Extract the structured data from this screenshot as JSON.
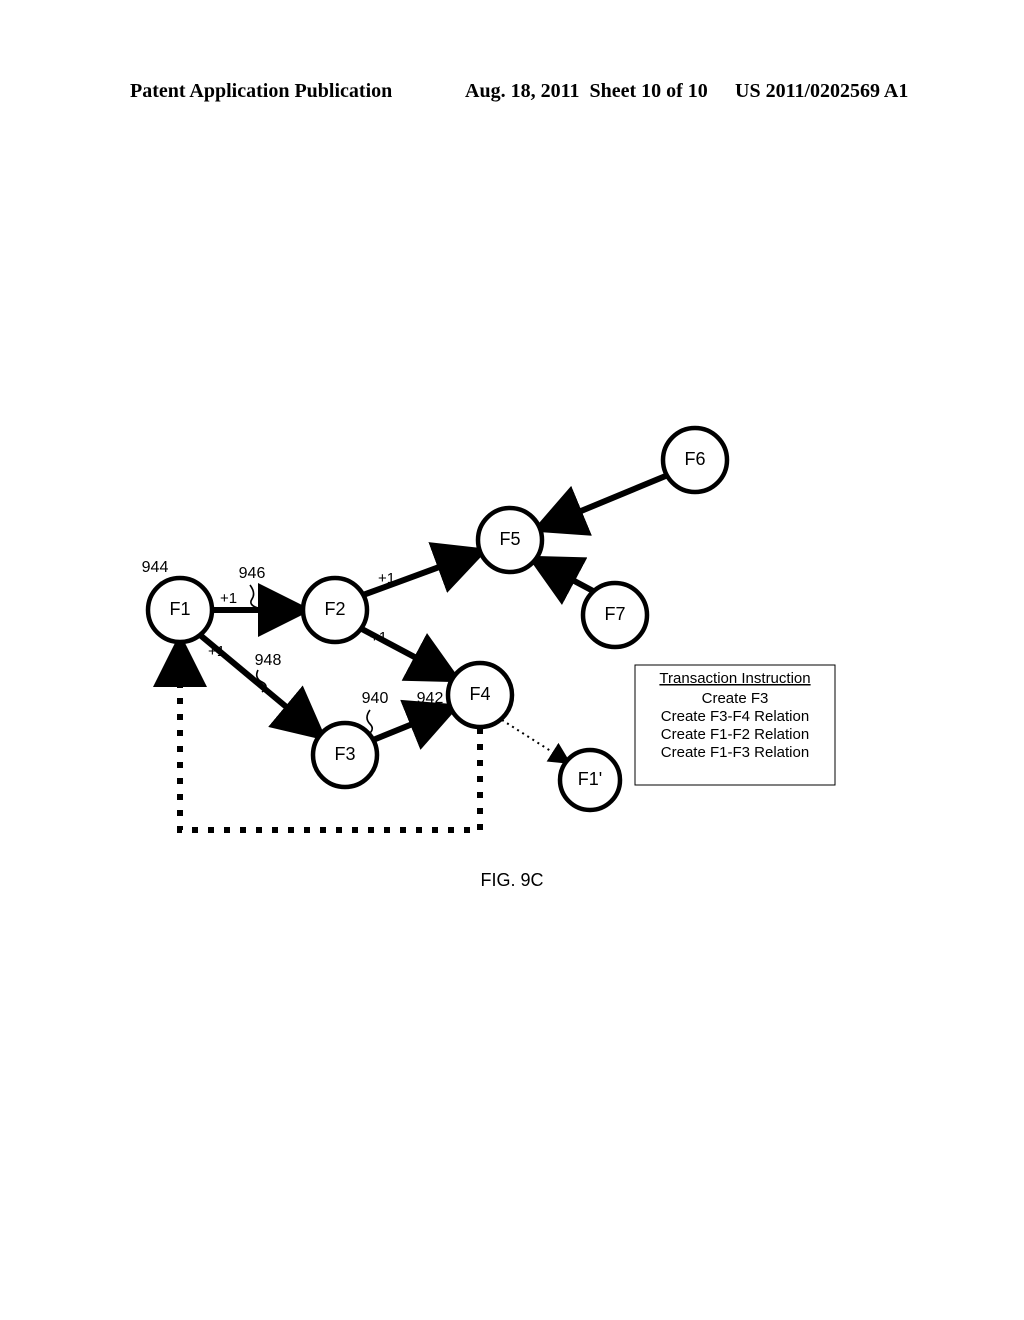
{
  "header": {
    "left": "Patent Application Publication",
    "date": "Aug. 18, 2011",
    "sheet": "Sheet 10 of 10",
    "pubno": "US 2011/0202569 A1"
  },
  "figure_caption": "FIG. 9C",
  "nodes": {
    "F1": "F1",
    "F2": "F2",
    "F3": "F3",
    "F4": "F4",
    "F5": "F5",
    "F6": "F6",
    "F7": "F7",
    "F1p": "F1'"
  },
  "refs": {
    "r944": "944",
    "r946": "946",
    "r940": "940",
    "r942": "942",
    "r948": "948"
  },
  "plusone": "+1",
  "box": {
    "title": "Transaction Instruction",
    "l1": "Create F3",
    "l2": "Create F3-F4 Relation",
    "l3": "Create F1-F2 Relation",
    "l4": "Create F1-F3 Relation"
  }
}
